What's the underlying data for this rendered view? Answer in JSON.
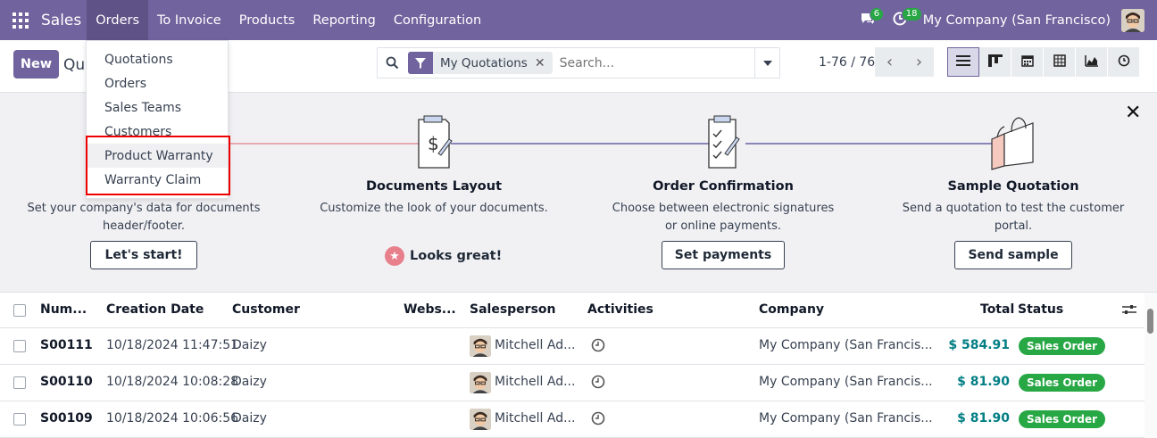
{
  "topbar": {
    "app_name": "Sales",
    "menus": [
      "Orders",
      "To Invoice",
      "Products",
      "Reporting",
      "Configuration"
    ],
    "messages_count": "6",
    "activities_count": "18",
    "company": "My Company (San Francisco)"
  },
  "control": {
    "new_label": "New",
    "breadcrumb": "Quo",
    "filter_facet": "My Quotations",
    "search_placeholder": "Search...",
    "pager": "1-76 / 76"
  },
  "orders_menu": {
    "items": [
      "Quotations",
      "Orders",
      "Sales Teams",
      "Customers",
      "Product Warranty",
      "Warranty Claim"
    ]
  },
  "banner": {
    "steps": [
      {
        "title": "",
        "desc_line1": "Set your company's data for documents",
        "desc_line2": "header/footer.",
        "button": "Let's start!"
      },
      {
        "title": "Documents Layout",
        "desc_line1": "Customize the look of your documents.",
        "desc_line2": "",
        "button": "Looks great!"
      },
      {
        "title": "Order Confirmation",
        "desc_line1": "Choose between electronic signatures",
        "desc_line2": "or online payments.",
        "button": "Set payments"
      },
      {
        "title": "Sample Quotation",
        "desc_line1": "Send a quotation to test the customer",
        "desc_line2": "portal.",
        "button": "Send sample"
      }
    ]
  },
  "table": {
    "headers": [
      "Num...",
      "Creation Date",
      "Customer",
      "Webs...",
      "Salesperson",
      "Activities",
      "Company",
      "Total",
      "Status"
    ],
    "rows": [
      {
        "number": "S00111",
        "date": "10/18/2024 11:47:51",
        "customer": "Daizy",
        "salesperson": "Mitchell Ad...",
        "company": "My Company (San Francis...",
        "total": "$ 584.91",
        "status": "Sales Order"
      },
      {
        "number": "S00110",
        "date": "10/18/2024 10:08:28",
        "customer": "Daizy",
        "salesperson": "Mitchell Ad...",
        "company": "My Company (San Francis...",
        "total": "$ 81.90",
        "status": "Sales Order"
      },
      {
        "number": "S00109",
        "date": "10/18/2024 10:06:56",
        "customer": "Daizy",
        "salesperson": "Mitchell Ad...",
        "company": "My Company (San Francis...",
        "total": "$ 81.90",
        "status": "Sales Order"
      }
    ]
  },
  "colors": {
    "brand": "#71639e",
    "status_green": "#28a745",
    "total_teal": "#017e84",
    "highlight_red": "#e00000"
  }
}
